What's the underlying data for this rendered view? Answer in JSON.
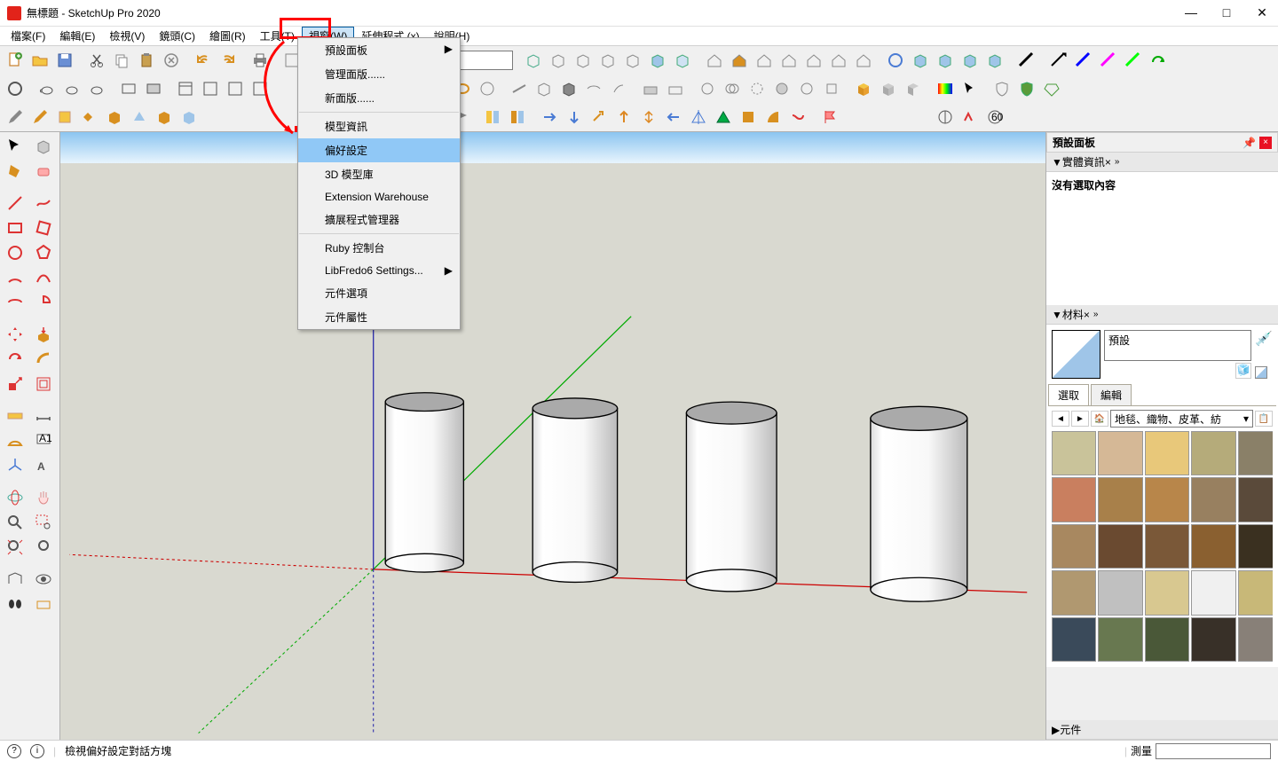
{
  "title": "無標題 - SketchUp Pro 2020",
  "menu": {
    "items": [
      "檔案(F)",
      "編輯(E)",
      "檢視(V)",
      "鏡頭(C)",
      "繪圖(R)",
      "工具(T)",
      "視窗(W)",
      "延伸程式 (x)",
      "說明(H)"
    ],
    "highlighted_index": 6
  },
  "dropdown": {
    "items": [
      {
        "label": "預設面板",
        "arrow": true
      },
      {
        "label": "管理面版......"
      },
      {
        "label": "新面版......"
      },
      {
        "sep": true
      },
      {
        "label": "模型資訊"
      },
      {
        "label": "偏好設定",
        "highlighted": true
      },
      {
        "label": "3D 模型庫"
      },
      {
        "label": "Extension Warehouse"
      },
      {
        "label": "擴展程式管理器"
      },
      {
        "sep": true
      },
      {
        "label": "Ruby 控制台"
      },
      {
        "label": "LibFredo6 Settings...",
        "arrow": true
      },
      {
        "label": "元件選項"
      },
      {
        "label": "元件屬性"
      }
    ]
  },
  "panels": {
    "tray_title": "預設面板",
    "entity": {
      "title": "實體資訊",
      "content": "沒有選取內容"
    },
    "materials": {
      "title": "材料",
      "current_name": "預設",
      "tabs": [
        "選取",
        "編輯"
      ],
      "category": "地毯、織物、皮革、紡",
      "swatches": [
        "#c9c39a",
        "#d5b896",
        "#e8c87a",
        "#b5ab7a",
        "#8a8068",
        "#c97f5f",
        "#a8804a",
        "#b8864a",
        "#988060",
        "#5a4a3a",
        "#a88860",
        "#6a4a30",
        "#7a5838",
        "#8a6030",
        "#3a3020",
        "#b09870",
        "#c0c0c0",
        "#d8c890",
        "#f0f0f0",
        "#c8b878",
        "#3a4a5a",
        "#687850",
        "#4a5838",
        "#383028",
        "#888078"
      ]
    },
    "components": {
      "title": "元件"
    }
  },
  "status": {
    "hint": "檢視偏好設定對話方塊",
    "measure_label": "測量"
  }
}
